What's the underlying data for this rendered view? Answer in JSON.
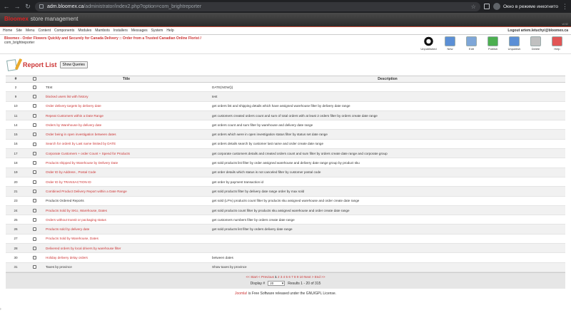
{
  "browser": {
    "url_host": "adm.bloomex.ca",
    "url_path": "/administrator/index2.php?option=com_brightreporter",
    "incognito_label": "Окно в режиме инкогнито"
  },
  "header": {
    "logo": "Bloomex",
    "logo_sub": "store management",
    "version": "v0.52"
  },
  "menu": {
    "items": [
      "Home",
      "Site",
      "Menu",
      "Content",
      "Components",
      "Modules",
      "Mambots",
      "Installers",
      "Messages",
      "System",
      "Help"
    ],
    "logout": "Logout artem.letuchyi@bloomex.ca"
  },
  "pathway": {
    "site": "Bloomex - Order Flowers Quickly and Securely for Canada Delivery :: Order from a Trusted Canadian Online Florist /",
    "component": "com_brightreporter"
  },
  "toolbar": [
    {
      "label": "Unpublished",
      "icon": "unpublished-icon",
      "color": "#ffffff"
    },
    {
      "label": "New",
      "icon": "new-icon",
      "color": "#5b8fd6"
    },
    {
      "label": "Edit",
      "icon": "edit-icon",
      "color": "#7ea6d8"
    },
    {
      "label": "Publish",
      "icon": "publish-icon",
      "color": "#4caf50"
    },
    {
      "label": "Unpublish",
      "icon": "unpublish-icon",
      "color": "#5b8fd6"
    },
    {
      "label": "Delete",
      "icon": "delete-icon",
      "color": "#c0c0c0"
    },
    {
      "label": "Help",
      "icon": "help-icon",
      "color": "#e25555"
    }
  ],
  "page": {
    "title": "Report List",
    "show_queries": "Show Queries"
  },
  "table": {
    "headers": {
      "num": "#",
      "title": "Title",
      "description": "Description"
    },
    "rows": [
      {
        "id": "2",
        "title": "TEst",
        "desc": "DATE(NOW())",
        "link": false
      },
      {
        "id": "9",
        "title": "blocked users list with history",
        "desc": "test",
        "link": true
      },
      {
        "id": "10",
        "title": "Order delivery targets by delivery date",
        "desc": "get orders list and shipping details which have assigned warehouse filter by delivery date range",
        "link": true
      },
      {
        "id": "11",
        "title": "Repeat Customers within a Date Range",
        "desc": "get customers created orders count and sum of total orders with at least 2 orders filter by orders create date range",
        "link": true
      },
      {
        "id": "14",
        "title": "Orders by Warehouse by delivery date",
        "desc": "get orders count and sum filter by warehouse and delivery date range",
        "link": true
      },
      {
        "id": "15",
        "title": "Order being in open investigation between dates",
        "desc": "get orders which were in open investigation status filter by status set date range",
        "link": true
      },
      {
        "id": "16",
        "title": "Search for orderit by Last name limited by DATE",
        "desc": "get orders details search by customer last name and order create date range",
        "link": true
      },
      {
        "id": "17",
        "title": "Corporate Customers + order Count + Spend for Products",
        "desc": "get corporate customers details and created orders count and sum filter by orders create date range and corporate group",
        "link": true
      },
      {
        "id": "18",
        "title": "Products shipped by Warehouse by Delivery Date",
        "desc": "get sold products list filter by order assigned warehouse and delivery date range group by product sku",
        "link": true
      },
      {
        "id": "19",
        "title": "Order ID by Address , Postal Code",
        "desc": "get order details which status is not canceled filter by customer postal code",
        "link": true
      },
      {
        "id": "20",
        "title": "Order ID by TRANSACTION ID",
        "desc": "get order by payment transaction id",
        "link": true
      },
      {
        "id": "21",
        "title": "Combined Product Delivery Report within a Date Range",
        "desc": "get sold products filter by delivery date range order by max sold",
        "link": true
      },
      {
        "id": "23",
        "title": "Products Ordered Reports",
        "desc": "get sold (LF%) products count filter by products sku assigned warehouse and order create date range",
        "link": false
      },
      {
        "id": "24",
        "title": "Products Sold by SKU, Warehouse, Dates",
        "desc": "get sold products count filter by products sku assigned warehouse and order create date range",
        "link": true
      },
      {
        "id": "25",
        "title": "Orders without transit or packaging status",
        "desc": "get customers numbers filter by orders create date range",
        "link": true
      },
      {
        "id": "26",
        "title": "Products sold by delivery date",
        "desc": "get sold products list filter by orders delivery date range",
        "link": true
      },
      {
        "id": "27",
        "title": "Products Sold by Warehouse, Dates",
        "desc": "",
        "link": true
      },
      {
        "id": "28",
        "title": "Delivered orders by local drivers by warehouse filter",
        "desc": "",
        "link": true
      },
      {
        "id": "30",
        "title": "Holiday delivery delay orders",
        "desc": "between dates",
        "link": true
      },
      {
        "id": "31",
        "title": "Taxes by province",
        "desc": "Show taxes by province",
        "link": false
      }
    ]
  },
  "pagination": {
    "text_start": "<< Start < Previous ",
    "current": "1",
    "pages": " 2 3 4 5 6 7 8 9 10 ",
    "text_end": "Next > End >>",
    "display_label": "Display #",
    "limit": "20",
    "results": "Results 1 - 20 of 315"
  },
  "footer": {
    "brand": "Joomla!",
    "text": " is Free Software released under the GNU/GPL License."
  }
}
